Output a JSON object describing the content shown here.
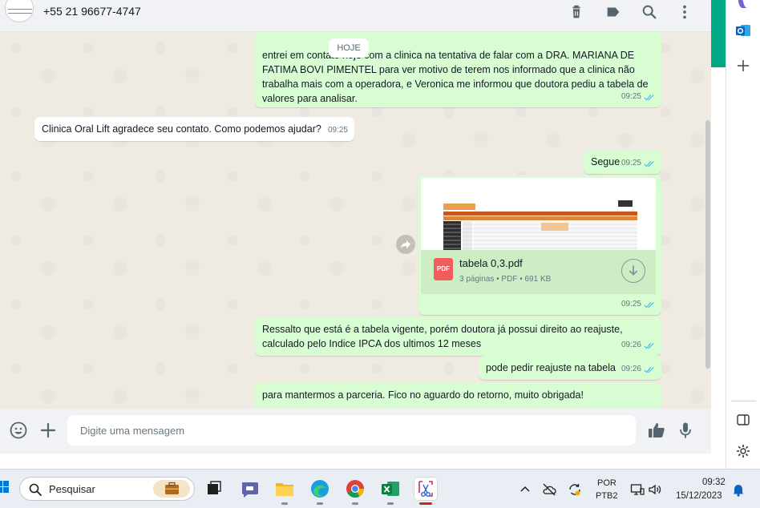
{
  "header": {
    "contact_name": "+55 21 96677-4747",
    "icons": [
      "delete-icon",
      "label-icon",
      "search-icon",
      "more-vert-icon"
    ]
  },
  "chat": {
    "day_chip": "HOJE",
    "messages": [
      {
        "direction": "outgoing",
        "text": "entrei em contato hoje com a clinica na tentativa de falar com a DRA. MARIANA DE FATIMA BOVI PIMENTEL para ver motivo de terem nos informado que a clinica não trabalha mais com a operadora, e Veronica me informou que doutora pediu a tabela de valores para analisar.",
        "time": "09:25",
        "read": true
      },
      {
        "direction": "incoming",
        "text": "Clinica Oral Lift agradece seu contato. Como podemos ajudar?",
        "time": "09:25"
      },
      {
        "direction": "outgoing",
        "text": "Segue",
        "time": "09:25",
        "read": true
      },
      {
        "direction": "outgoing",
        "type": "document",
        "file_name": "tabela 0,3.pdf",
        "file_info": "3 páginas • PDF • 691 KB",
        "file_icon": "PDF",
        "time": "09:25",
        "read": true
      },
      {
        "direction": "outgoing",
        "text": "Ressalto que está é a tabela vigente, porém doutora já possui direito ao reajuste, calculado pelo Indice IPCA dos ultimos 12 meses",
        "time": "09:26",
        "read": true
      },
      {
        "direction": "outgoing",
        "text": "pode pedir reajuste na tabela",
        "time": "09:26",
        "read": true
      },
      {
        "direction": "outgoing",
        "text": "para mantermos a parceria. Fico no aguardo do retorno, muito obrigada!",
        "time": "",
        "read": true
      }
    ]
  },
  "composer": {
    "placeholder": "Digite uma mensagem",
    "value": ""
  },
  "taskbar": {
    "search_placeholder": "Pesquisar",
    "apps": [
      "task-view",
      "teams",
      "file-explorer",
      "edge",
      "chrome",
      "excel",
      "snipping-tool"
    ],
    "active_app": "snipping-tool",
    "lang_line1": "POR",
    "lang_line2": "PTB2",
    "clock_time": "09:32",
    "clock_date": "15/12/2023"
  },
  "colors": {
    "accent": "#00a884",
    "outgoing_bubble": "#d9fdd3",
    "incoming_bubble": "#ffffff",
    "read_ticks": "#53bdeb",
    "chat_background": "#efeae2",
    "pdf_red": "#f15c5c"
  }
}
